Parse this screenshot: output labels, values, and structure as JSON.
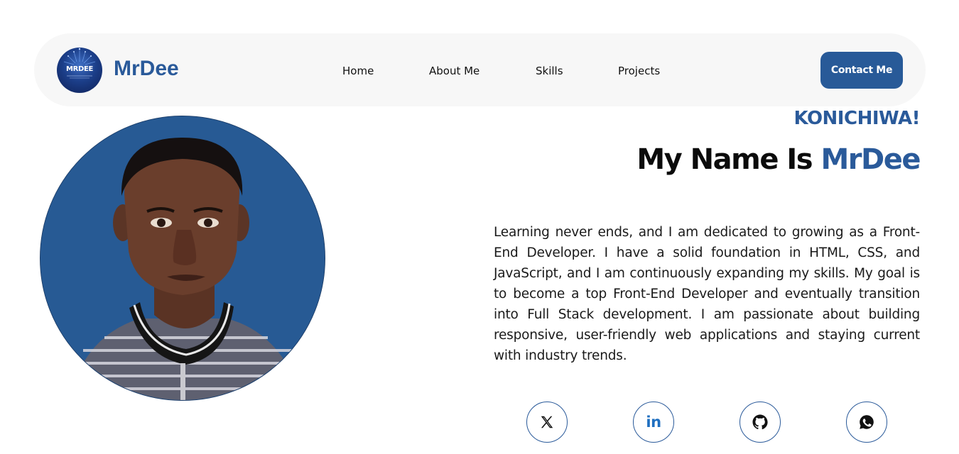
{
  "header": {
    "logo_text": "MRDEE",
    "brand_name": "MrDee",
    "nav": [
      "Home",
      "About Me",
      "Skills",
      "Projects"
    ],
    "contact_label": "Contact Me"
  },
  "hero": {
    "greeting": "KONICHIWA!",
    "headline_prefix": "My Name Is ",
    "headline_name": "MrDee",
    "bio": "Learning never ends, and I am dedicated to growing as a Front-End Developer. I have a solid foundation in HTML, CSS, and JavaScript, and I am continuously expanding my skills. My goal is to become a top Front-End Developer and eventually transition into Full Stack development. I am passionate about building responsive, user-friendly web applications and staying current with industry trends."
  },
  "social": {
    "linkedin_glyph": "in",
    "icons": [
      "x-icon",
      "linkedin-icon",
      "github-icon",
      "whatsapp-icon"
    ]
  },
  "colors": {
    "accent": "#2a5a9a",
    "portrait_bg": "#275a94",
    "navbar_bg": "#f7f7f7",
    "button_bg": "#285a98"
  }
}
